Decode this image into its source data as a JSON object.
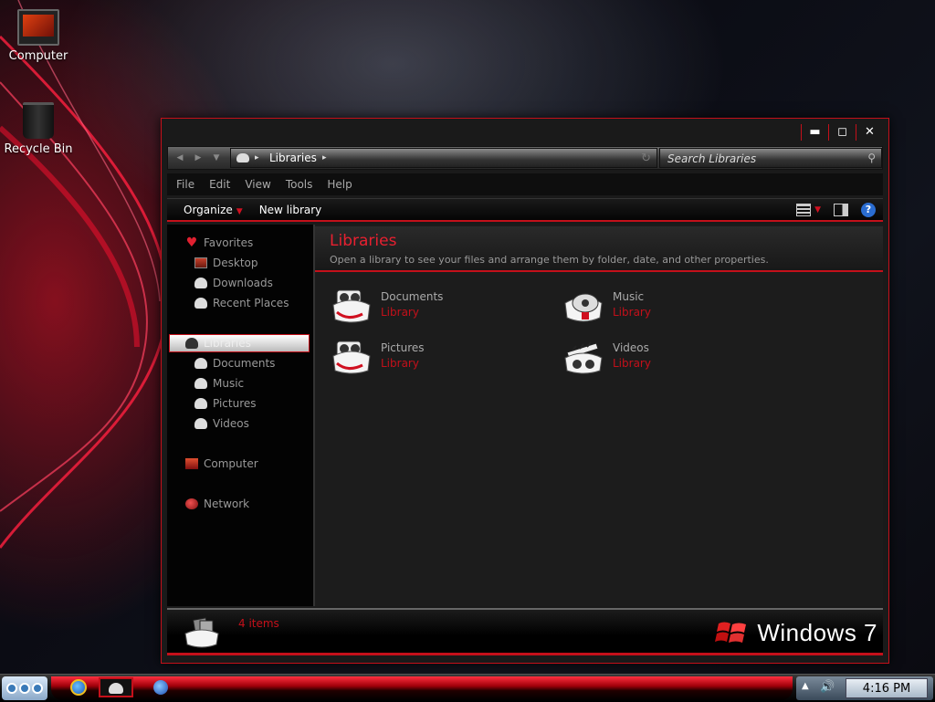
{
  "desktop": {
    "icons": [
      {
        "label": "Computer",
        "icon": "computer-icon"
      },
      {
        "label": "Recycle Bin",
        "icon": "recycle-bin-icon"
      }
    ]
  },
  "window": {
    "caption_buttons": {
      "minimize": "▬",
      "maximize": "◻",
      "close": "✕"
    },
    "nav": {
      "back": "◀",
      "forward": "▶",
      "recent": "▼"
    },
    "address": {
      "path": "Libraries",
      "separator": "▸",
      "refresh": "↻"
    },
    "search": {
      "placeholder": "Search Libraries"
    },
    "menu": [
      "File",
      "Edit",
      "View",
      "Tools",
      "Help"
    ],
    "toolbar": {
      "organize": "Organize",
      "new_library": "New library",
      "help": "?"
    },
    "nav_pane": {
      "favorites": "Favorites",
      "favorite_items": [
        "Desktop",
        "Downloads",
        "Recent Places"
      ],
      "libraries": "Libraries",
      "library_items": [
        "Documents",
        "Music",
        "Pictures",
        "Videos"
      ],
      "computer": "Computer",
      "network": "Network"
    },
    "content": {
      "title": "Libraries",
      "description": "Open a library to see your files and arrange them by folder, date, and other properties.",
      "libraries": [
        {
          "name": "Documents",
          "type": "Library",
          "icon": "documents-library-icon"
        },
        {
          "name": "Music",
          "type": "Library",
          "icon": "music-library-icon"
        },
        {
          "name": "Pictures",
          "type": "Library",
          "icon": "pictures-library-icon"
        },
        {
          "name": "Videos",
          "type": "Library",
          "icon": "videos-library-icon"
        }
      ]
    },
    "details": {
      "count": "4 items",
      "brand": "Windows 7"
    }
  },
  "taskbar": {
    "clock": "4:16 PM",
    "tray_up": "▲",
    "volume": "🔊"
  },
  "colors": {
    "accent": "#c4101a",
    "highlight": "#e82030"
  }
}
